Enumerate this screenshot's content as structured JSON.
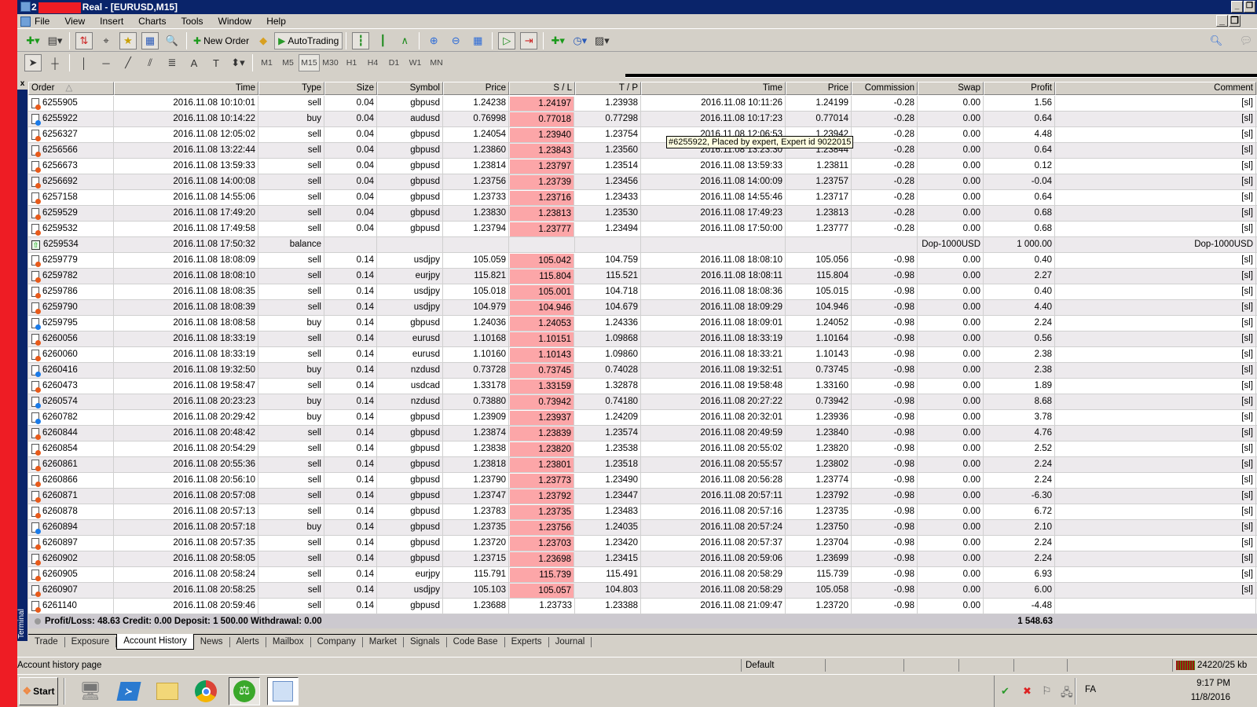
{
  "window": {
    "title_prefix": "2",
    "title_suffix": "Real - [EURUSD,M15]",
    "minimize_icon": "minimize-icon",
    "restore_icon": "restore-icon"
  },
  "menu": [
    "File",
    "View",
    "Insert",
    "Charts",
    "Tools",
    "Window",
    "Help"
  ],
  "toolbar": {
    "new_order": "New Order",
    "autotrading": "AutoTrading",
    "timeframes": [
      "M1",
      "M5",
      "M15",
      "M30",
      "H1",
      "H4",
      "D1",
      "W1",
      "MN"
    ],
    "active_timeframe": "M15"
  },
  "terminal": {
    "label": "Terminal",
    "close": "x"
  },
  "table": {
    "headers": [
      "Order",
      "Time",
      "Type",
      "Size",
      "Symbol",
      "Price",
      "S / L",
      "T / P",
      "Time",
      "Price",
      "Commission",
      "Swap",
      "Profit",
      "Comment"
    ],
    "sort_indicator": "△",
    "rows": [
      {
        "order": "6255905",
        "time": "2016.11.08 10:10:01",
        "type": "sell",
        "size": "0.04",
        "symbol": "gbpusd",
        "price": "1.24238",
        "sl": "1.24197",
        "tp": "1.23938",
        "ctime": "2016.11.08 10:11:26",
        "cprice": "1.24199",
        "commission": "-0.28",
        "swap": "0.00",
        "profit": "1.56",
        "comment": "[sl]"
      },
      {
        "order": "6255922",
        "time": "2016.11.08 10:14:22",
        "type": "buy",
        "size": "0.04",
        "symbol": "audusd",
        "price": "0.76998",
        "sl": "0.77018",
        "tp": "0.77298",
        "ctime": "2016.11.08 10:17:23",
        "cprice": "0.77014",
        "commission": "-0.28",
        "swap": "0.00",
        "profit": "0.64",
        "comment": "[sl]"
      },
      {
        "order": "6256327",
        "time": "2016.11.08 12:05:02",
        "type": "sell",
        "size": "0.04",
        "symbol": "gbpusd",
        "price": "1.24054",
        "sl": "1.23940",
        "tp": "1.23754",
        "ctime": "2016.11.08 12:06:53",
        "cprice": "1.23942",
        "commission": "-0.28",
        "swap": "0.00",
        "profit": "4.48",
        "comment": "[sl]"
      },
      {
        "order": "6256566",
        "time": "2016.11.08 13:22:44",
        "type": "sell",
        "size": "0.04",
        "symbol": "gbpusd",
        "price": "1.23860",
        "sl": "1.23843",
        "tp": "1.23560",
        "ctime": "2016.11.08 13:23:30",
        "cprice": "1.23844",
        "commission": "-0.28",
        "swap": "0.00",
        "profit": "0.64",
        "comment": "[sl]"
      },
      {
        "order": "6256673",
        "time": "2016.11.08 13:59:33",
        "type": "sell",
        "size": "0.04",
        "symbol": "gbpusd",
        "price": "1.23814",
        "sl": "1.23797",
        "tp": "1.23514",
        "ctime": "2016.11.08 13:59:33",
        "cprice": "1.23811",
        "commission": "-0.28",
        "swap": "0.00",
        "profit": "0.12",
        "comment": "[sl]"
      },
      {
        "order": "6256692",
        "time": "2016.11.08 14:00:08",
        "type": "sell",
        "size": "0.04",
        "symbol": "gbpusd",
        "price": "1.23756",
        "sl": "1.23739",
        "tp": "1.23456",
        "ctime": "2016.11.08 14:00:09",
        "cprice": "1.23757",
        "commission": "-0.28",
        "swap": "0.00",
        "profit": "-0.04",
        "comment": "[sl]"
      },
      {
        "order": "6257158",
        "time": "2016.11.08 14:55:06",
        "type": "sell",
        "size": "0.04",
        "symbol": "gbpusd",
        "price": "1.23733",
        "sl": "1.23716",
        "tp": "1.23433",
        "ctime": "2016.11.08 14:55:46",
        "cprice": "1.23717",
        "commission": "-0.28",
        "swap": "0.00",
        "profit": "0.64",
        "comment": "[sl]"
      },
      {
        "order": "6259529",
        "time": "2016.11.08 17:49:20",
        "type": "sell",
        "size": "0.04",
        "symbol": "gbpusd",
        "price": "1.23830",
        "sl": "1.23813",
        "tp": "1.23530",
        "ctime": "2016.11.08 17:49:23",
        "cprice": "1.23813",
        "commission": "-0.28",
        "swap": "0.00",
        "profit": "0.68",
        "comment": "[sl]"
      },
      {
        "order": "6259532",
        "time": "2016.11.08 17:49:58",
        "type": "sell",
        "size": "0.04",
        "symbol": "gbpusd",
        "price": "1.23794",
        "sl": "1.23777",
        "tp": "1.23494",
        "ctime": "2016.11.08 17:50:00",
        "cprice": "1.23777",
        "commission": "-0.28",
        "swap": "0.00",
        "profit": "0.68",
        "comment": "[sl]"
      },
      {
        "order": "6259534",
        "time": "2016.11.08 17:50:32",
        "type": "balance",
        "size": "",
        "symbol": "",
        "price": "",
        "sl": "",
        "tp": "",
        "ctime": "",
        "cprice": "",
        "commission": "",
        "swap": "Dop-1000USD",
        "profit": "1 000.00",
        "comment": "Dop-1000USD"
      },
      {
        "order": "6259779",
        "time": "2016.11.08 18:08:09",
        "type": "sell",
        "size": "0.14",
        "symbol": "usdjpy",
        "price": "105.059",
        "sl": "105.042",
        "tp": "104.759",
        "ctime": "2016.11.08 18:08:10",
        "cprice": "105.056",
        "commission": "-0.98",
        "swap": "0.00",
        "profit": "0.40",
        "comment": "[sl]"
      },
      {
        "order": "6259782",
        "time": "2016.11.08 18:08:10",
        "type": "sell",
        "size": "0.14",
        "symbol": "eurjpy",
        "price": "115.821",
        "sl": "115.804",
        "tp": "115.521",
        "ctime": "2016.11.08 18:08:11",
        "cprice": "115.804",
        "commission": "-0.98",
        "swap": "0.00",
        "profit": "2.27",
        "comment": "[sl]"
      },
      {
        "order": "6259786",
        "time": "2016.11.08 18:08:35",
        "type": "sell",
        "size": "0.14",
        "symbol": "usdjpy",
        "price": "105.018",
        "sl": "105.001",
        "tp": "104.718",
        "ctime": "2016.11.08 18:08:36",
        "cprice": "105.015",
        "commission": "-0.98",
        "swap": "0.00",
        "profit": "0.40",
        "comment": "[sl]"
      },
      {
        "order": "6259790",
        "time": "2016.11.08 18:08:39",
        "type": "sell",
        "size": "0.14",
        "symbol": "usdjpy",
        "price": "104.979",
        "sl": "104.946",
        "tp": "104.679",
        "ctime": "2016.11.08 18:09:29",
        "cprice": "104.946",
        "commission": "-0.98",
        "swap": "0.00",
        "profit": "4.40",
        "comment": "[sl]"
      },
      {
        "order": "6259795",
        "time": "2016.11.08 18:08:58",
        "type": "buy",
        "size": "0.14",
        "symbol": "gbpusd",
        "price": "1.24036",
        "sl": "1.24053",
        "tp": "1.24336",
        "ctime": "2016.11.08 18:09:01",
        "cprice": "1.24052",
        "commission": "-0.98",
        "swap": "0.00",
        "profit": "2.24",
        "comment": "[sl]"
      },
      {
        "order": "6260056",
        "time": "2016.11.08 18:33:19",
        "type": "sell",
        "size": "0.14",
        "symbol": "eurusd",
        "price": "1.10168",
        "sl": "1.10151",
        "tp": "1.09868",
        "ctime": "2016.11.08 18:33:19",
        "cprice": "1.10164",
        "commission": "-0.98",
        "swap": "0.00",
        "profit": "0.56",
        "comment": "[sl]"
      },
      {
        "order": "6260060",
        "time": "2016.11.08 18:33:19",
        "type": "sell",
        "size": "0.14",
        "symbol": "eurusd",
        "price": "1.10160",
        "sl": "1.10143",
        "tp": "1.09860",
        "ctime": "2016.11.08 18:33:21",
        "cprice": "1.10143",
        "commission": "-0.98",
        "swap": "0.00",
        "profit": "2.38",
        "comment": "[sl]"
      },
      {
        "order": "6260416",
        "time": "2016.11.08 19:32:50",
        "type": "buy",
        "size": "0.14",
        "symbol": "nzdusd",
        "price": "0.73728",
        "sl": "0.73745",
        "tp": "0.74028",
        "ctime": "2016.11.08 19:32:51",
        "cprice": "0.73745",
        "commission": "-0.98",
        "swap": "0.00",
        "profit": "2.38",
        "comment": "[sl]"
      },
      {
        "order": "6260473",
        "time": "2016.11.08 19:58:47",
        "type": "sell",
        "size": "0.14",
        "symbol": "usdcad",
        "price": "1.33178",
        "sl": "1.33159",
        "tp": "1.32878",
        "ctime": "2016.11.08 19:58:48",
        "cprice": "1.33160",
        "commission": "-0.98",
        "swap": "0.00",
        "profit": "1.89",
        "comment": "[sl]"
      },
      {
        "order": "6260574",
        "time": "2016.11.08 20:23:23",
        "type": "buy",
        "size": "0.14",
        "symbol": "nzdusd",
        "price": "0.73880",
        "sl": "0.73942",
        "tp": "0.74180",
        "ctime": "2016.11.08 20:27:22",
        "cprice": "0.73942",
        "commission": "-0.98",
        "swap": "0.00",
        "profit": "8.68",
        "comment": "[sl]"
      },
      {
        "order": "6260782",
        "time": "2016.11.08 20:29:42",
        "type": "buy",
        "size": "0.14",
        "symbol": "gbpusd",
        "price": "1.23909",
        "sl": "1.23937",
        "tp": "1.24209",
        "ctime": "2016.11.08 20:32:01",
        "cprice": "1.23936",
        "commission": "-0.98",
        "swap": "0.00",
        "profit": "3.78",
        "comment": "[sl]"
      },
      {
        "order": "6260844",
        "time": "2016.11.08 20:48:42",
        "type": "sell",
        "size": "0.14",
        "symbol": "gbpusd",
        "price": "1.23874",
        "sl": "1.23839",
        "tp": "1.23574",
        "ctime": "2016.11.08 20:49:59",
        "cprice": "1.23840",
        "commission": "-0.98",
        "swap": "0.00",
        "profit": "4.76",
        "comment": "[sl]"
      },
      {
        "order": "6260854",
        "time": "2016.11.08 20:54:29",
        "type": "sell",
        "size": "0.14",
        "symbol": "gbpusd",
        "price": "1.23838",
        "sl": "1.23820",
        "tp": "1.23538",
        "ctime": "2016.11.08 20:55:02",
        "cprice": "1.23820",
        "commission": "-0.98",
        "swap": "0.00",
        "profit": "2.52",
        "comment": "[sl]"
      },
      {
        "order": "6260861",
        "time": "2016.11.08 20:55:36",
        "type": "sell",
        "size": "0.14",
        "symbol": "gbpusd",
        "price": "1.23818",
        "sl": "1.23801",
        "tp": "1.23518",
        "ctime": "2016.11.08 20:55:57",
        "cprice": "1.23802",
        "commission": "-0.98",
        "swap": "0.00",
        "profit": "2.24",
        "comment": "[sl]"
      },
      {
        "order": "6260866",
        "time": "2016.11.08 20:56:10",
        "type": "sell",
        "size": "0.14",
        "symbol": "gbpusd",
        "price": "1.23790",
        "sl": "1.23773",
        "tp": "1.23490",
        "ctime": "2016.11.08 20:56:28",
        "cprice": "1.23774",
        "commission": "-0.98",
        "swap": "0.00",
        "profit": "2.24",
        "comment": "[sl]"
      },
      {
        "order": "6260871",
        "time": "2016.11.08 20:57:08",
        "type": "sell",
        "size": "0.14",
        "symbol": "gbpusd",
        "price": "1.23747",
        "sl": "1.23792",
        "tp": "1.23447",
        "ctime": "2016.11.08 20:57:11",
        "cprice": "1.23792",
        "commission": "-0.98",
        "swap": "0.00",
        "profit": "-6.30",
        "comment": "[sl]"
      },
      {
        "order": "6260878",
        "time": "2016.11.08 20:57:13",
        "type": "sell",
        "size": "0.14",
        "symbol": "gbpusd",
        "price": "1.23783",
        "sl": "1.23735",
        "tp": "1.23483",
        "ctime": "2016.11.08 20:57:16",
        "cprice": "1.23735",
        "commission": "-0.98",
        "swap": "0.00",
        "profit": "6.72",
        "comment": "[sl]"
      },
      {
        "order": "6260894",
        "time": "2016.11.08 20:57:18",
        "type": "buy",
        "size": "0.14",
        "symbol": "gbpusd",
        "price": "1.23735",
        "sl": "1.23756",
        "tp": "1.24035",
        "ctime": "2016.11.08 20:57:24",
        "cprice": "1.23750",
        "commission": "-0.98",
        "swap": "0.00",
        "profit": "2.10",
        "comment": "[sl]"
      },
      {
        "order": "6260897",
        "time": "2016.11.08 20:57:35",
        "type": "sell",
        "size": "0.14",
        "symbol": "gbpusd",
        "price": "1.23720",
        "sl": "1.23703",
        "tp": "1.23420",
        "ctime": "2016.11.08 20:57:37",
        "cprice": "1.23704",
        "commission": "-0.98",
        "swap": "0.00",
        "profit": "2.24",
        "comment": "[sl]"
      },
      {
        "order": "6260902",
        "time": "2016.11.08 20:58:05",
        "type": "sell",
        "size": "0.14",
        "symbol": "gbpusd",
        "price": "1.23715",
        "sl": "1.23698",
        "tp": "1.23415",
        "ctime": "2016.11.08 20:59:06",
        "cprice": "1.23699",
        "commission": "-0.98",
        "swap": "0.00",
        "profit": "2.24",
        "comment": "[sl]"
      },
      {
        "order": "6260905",
        "time": "2016.11.08 20:58:24",
        "type": "sell",
        "size": "0.14",
        "symbol": "eurjpy",
        "price": "115.791",
        "sl": "115.739",
        "tp": "115.491",
        "ctime": "2016.11.08 20:58:29",
        "cprice": "115.739",
        "commission": "-0.98",
        "swap": "0.00",
        "profit": "6.93",
        "comment": "[sl]"
      },
      {
        "order": "6260907",
        "time": "2016.11.08 20:58:25",
        "type": "sell",
        "size": "0.14",
        "symbol": "usdjpy",
        "price": "105.103",
        "sl": "105.057",
        "tp": "104.803",
        "ctime": "2016.11.08 20:58:29",
        "cprice": "105.058",
        "commission": "-0.98",
        "swap": "0.00",
        "profit": "6.00",
        "comment": "[sl]"
      },
      {
        "order": "6261140",
        "time": "2016.11.08 20:59:46",
        "type": "sell",
        "size": "0.14",
        "symbol": "gbpusd",
        "price": "1.23688",
        "sl": "1.23733",
        "tp": "1.23388",
        "ctime": "2016.11.08 21:09:47",
        "cprice": "1.23720",
        "commission": "-0.98",
        "swap": "0.00",
        "profit": "-4.48",
        "comment": "",
        "sl_hit": false
      }
    ],
    "summary": {
      "text": "Profit/Loss: 48.63  Credit: 0.00  Deposit: 1 500.00  Withdrawal: 0.00",
      "total": "1 548.63"
    },
    "tooltip": "#6255922, Placed by expert, Expert id 9022015",
    "colors": {
      "sl_highlight": "#fca6a8",
      "sell_dot": "#e85a1a",
      "buy_dot": "#1a7ae8",
      "row_alt": "#edeaed"
    }
  },
  "tabs": [
    "Trade",
    "Exposure",
    "Account History",
    "News",
    "Alerts",
    "Mailbox",
    "Company",
    "Market",
    "Signals",
    "Code Base",
    "Experts",
    "Journal"
  ],
  "active_tab": "Account History",
  "status": {
    "left": "Account history page",
    "profile": "Default",
    "traffic": "24220/25 kb"
  },
  "taskbar": {
    "start": "Start",
    "lang": "FA",
    "time": "9:17 PM",
    "date": "11/8/2016"
  }
}
